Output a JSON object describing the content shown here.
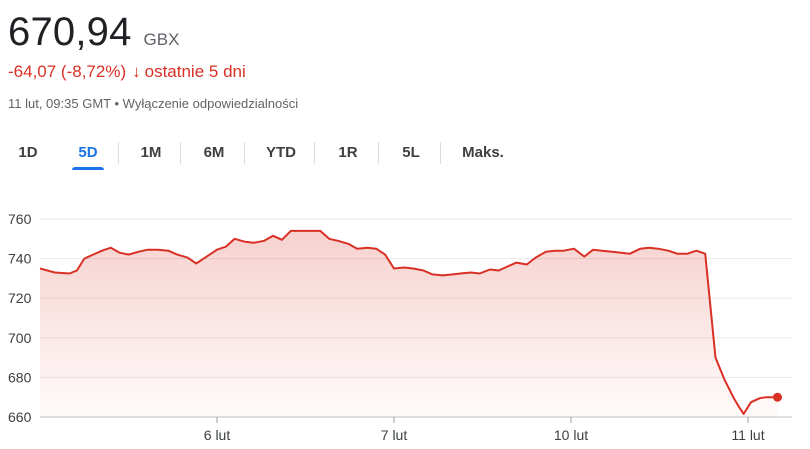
{
  "quote": {
    "price": "670,94",
    "currency": "GBX",
    "change": "-64,07 (-8,72%)",
    "change_arrow": "↓",
    "period": "ostatnie 5 dni",
    "timestamp": "11 lut, 09:35 GMT",
    "separator": "•",
    "disclaimer": "Wyłączenie odpowiedzialności"
  },
  "tabs": [
    {
      "label": "1D",
      "active": false
    },
    {
      "label": "5D",
      "active": true
    },
    {
      "label": "1M",
      "active": false
    },
    {
      "label": "6M",
      "active": false
    },
    {
      "label": "YTD",
      "active": false
    },
    {
      "label": "1R",
      "active": false
    },
    {
      "label": "5L",
      "active": false
    },
    {
      "label": "Maks.",
      "active": false
    }
  ],
  "colors": {
    "line": "#d93025",
    "accent": "#1a73e8",
    "grid": "#e8eaed"
  },
  "chart_data": {
    "type": "area",
    "title": "",
    "xlabel": "",
    "ylabel": "",
    "ylim": [
      660,
      760
    ],
    "yticks": [
      760,
      740,
      720,
      700,
      680,
      660
    ],
    "xlim": [
      0,
      60
    ],
    "xticks": [
      {
        "label": "6 lut",
        "x": 12
      },
      {
        "label": "7 lut",
        "x": 24
      },
      {
        "label": "10 lut",
        "x": 36
      },
      {
        "label": "11 lut",
        "x": 48
      }
    ],
    "grid": true,
    "x": [
      0,
      1,
      2,
      2.5,
      3,
      3.6,
      4.2,
      4.8,
      5.4,
      6,
      6.7,
      7.3,
      8,
      8.7,
      9.3,
      10,
      10.6,
      11.3,
      12,
      12.6,
      13.2,
      13.9,
      14.5,
      15.2,
      15.8,
      16.4,
      17,
      17.7,
      18.3,
      19,
      19.6,
      20.2,
      20.9,
      21.5,
      22.2,
      22.8,
      23.4,
      24,
      24.7,
      25.3,
      26,
      26.6,
      27.3,
      28,
      28.5,
      29.2,
      29.8,
      30.5,
      31.1,
      31.7,
      32.3,
      33,
      33.6,
      34.3,
      34.9,
      35.5,
      36.2,
      36.9,
      37.5,
      38.1,
      38.8,
      39.4,
      40,
      40.7,
      41.3,
      41.9,
      42.6,
      43.2,
      43.9,
      44.5,
      45.1,
      45.8,
      46.4,
      47,
      47.4,
      47.7,
      48.2,
      48.8,
      49.2,
      49.6,
      50
    ],
    "y": [
      735,
      733,
      732.5,
      734,
      740,
      742,
      744,
      745.5,
      743,
      742,
      743.5,
      744.5,
      744.5,
      744,
      742,
      740.5,
      737.5,
      741,
      744.5,
      746,
      750,
      748.5,
      748,
      749,
      751.5,
      749.5,
      754,
      754,
      754,
      754,
      750,
      749,
      747.5,
      745,
      745.5,
      745,
      742,
      735,
      735.5,
      735,
      734,
      732,
      731.5,
      732,
      732.5,
      733,
      732.5,
      734.5,
      734,
      736,
      738,
      737,
      740.5,
      743.5,
      744,
      744,
      745,
      741,
      744.5,
      744,
      743.5,
      743,
      742.5,
      745,
      745.5,
      745,
      744,
      742.5,
      742.5,
      744,
      742.5,
      690,
      679,
      670,
      665,
      661.5,
      667.5,
      669.5,
      670,
      670,
      670
    ],
    "last_value": 670.94
  }
}
